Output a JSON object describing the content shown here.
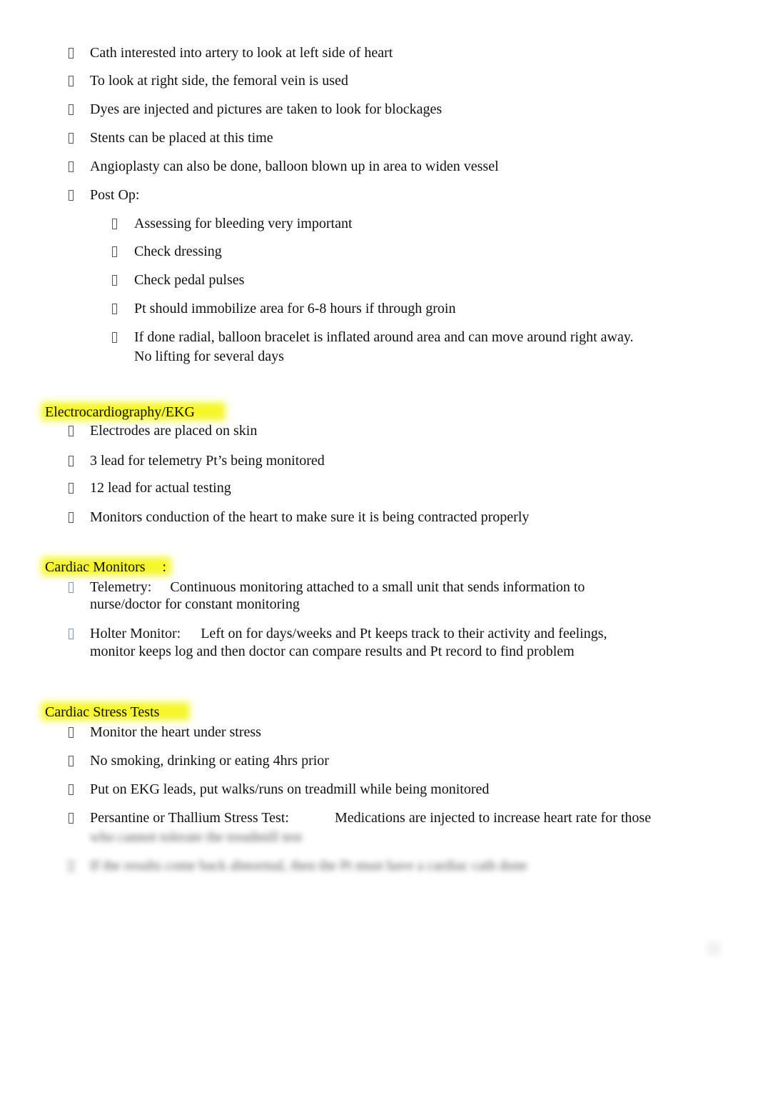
{
  "sections": [
    {
      "heading": null,
      "items": [
        {
          "text": "Cath interested into artery to look at left side of heart"
        },
        {
          "text": "To look at right side, the femoral vein is used"
        },
        {
          "text": "Dyes are injected and pictures are taken to look for blockages"
        },
        {
          "text": "Stents can be placed at this time"
        },
        {
          "text": "Angioplasty can also be done, balloon blown up in area to widen vessel"
        },
        {
          "text": "Post Op:",
          "subitems": [
            {
              "text": "Assessing for bleeding very important"
            },
            {
              "text": "Check dressing"
            },
            {
              "text": "Check pedal pulses"
            },
            {
              "text": "Pt should immobilize area for 6-8 hours if through groin"
            },
            {
              "text_line1": "If done radial, balloon bracelet is inflated around area and can move around right away.",
              "text_line2": "No lifting for several days"
            }
          ]
        }
      ]
    },
    {
      "heading": "Electrocardiography/EKG",
      "items": [
        {
          "text": "Electrodes are placed on skin"
        },
        {
          "text": "3 lead for telemetry Pt’s being monitored"
        },
        {
          "text": "12 lead for actual testing"
        },
        {
          "text": "Monitors conduction of the heart to make sure it is being contracted properly"
        }
      ]
    },
    {
      "heading": "Cardiac Monitors",
      "heading_suffix": ":",
      "items": [
        {
          "term": "Telemetry:",
          "text_line1": "Continuous monitoring attached to a small unit that sends information to",
          "text_line2": "nurse/doctor for constant monitoring"
        },
        {
          "term": "Holter Monitor:",
          "text_line1": "Left on for days/weeks and Pt keeps track to their activity and feelings,",
          "text_line2": "monitor keeps log and then doctor can compare results and Pt record to find problem"
        }
      ]
    },
    {
      "heading": "Cardiac Stress Tests",
      "items": [
        {
          "text": "Monitor the heart under stress"
        },
        {
          "text": "No smoking, drinking or eating 4hrs prior"
        },
        {
          "text": "Put on EKG leads, put walks/runs on treadmill while being monitored"
        },
        {
          "term": "Persantine or Thallium Stress Test:",
          "text_line1": "Medications are injected to increase heart rate for those",
          "text_line2_blurred": "who cannot tolerate the treadmill test"
        },
        {
          "text_blurred": "If the results come back abnormal, then the Pt must have a cardiac cath done"
        }
      ]
    }
  ],
  "colors": {
    "highlight": "#f6f62a",
    "text": "#111111",
    "bullet_blue": "#7f95b8"
  }
}
